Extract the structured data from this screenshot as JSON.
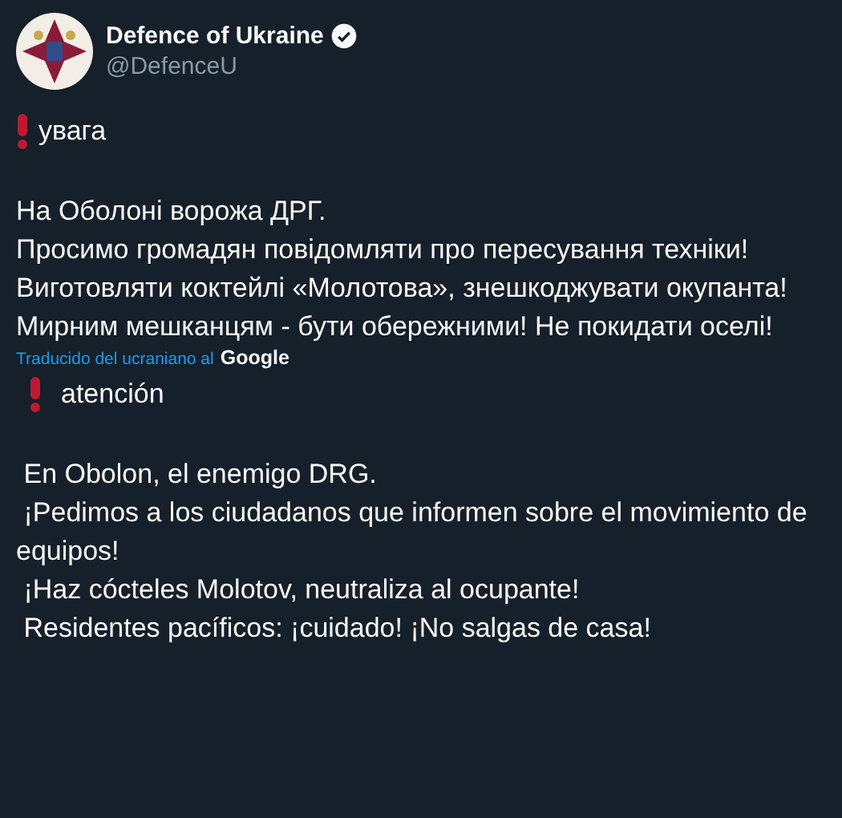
{
  "author": {
    "name": "Defence of Ukraine",
    "handle": "@DefenceU",
    "verified": true
  },
  "original": [
    {
      "kind": "alert",
      "text": "увага"
    },
    {
      "kind": "line",
      "text": "На Оболоні ворожа ДРГ."
    },
    {
      "kind": "line",
      "text": "Просимо громадян повідомляти про пересування техніки!"
    },
    {
      "kind": "line",
      "text": "Виготовляти коктейлі «Молотова», знешкоджувати окупанта!"
    },
    {
      "kind": "line",
      "text": "Мирним мешканцям - бути обережними! Не покидати оселі!"
    }
  ],
  "translation_note": {
    "text": "Traducido del ucraniano al",
    "provider": "Google"
  },
  "translation": [
    {
      "kind": "alert",
      "text": "atención"
    },
    {
      "kind": "line",
      "text": " En Obolon, el enemigo DRG."
    },
    {
      "kind": "line",
      "text": " ¡Pedimos a los ciudadanos que informen sobre el movimiento de equipos!"
    },
    {
      "kind": "line",
      "text": " ¡Haz cócteles Molotov, neutraliza al ocupante!"
    },
    {
      "kind": "line",
      "text": " Residentes pacíficos: ¡cuidado! ¡No salgas de casa!"
    }
  ]
}
